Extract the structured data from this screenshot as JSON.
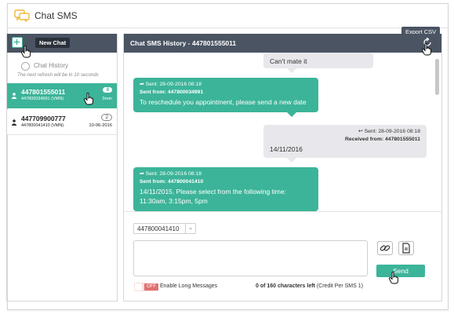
{
  "app": {
    "title": "Chat SMS",
    "export_label": "Export CSV"
  },
  "sidebar": {
    "new_chat_label": "New Chat",
    "history_title": "Chat History",
    "refresh_note": "The next refresh will be in 10 seconds",
    "items": [
      {
        "number": "447801555011",
        "sub": "447800034991 (VMN)",
        "badge": "4",
        "time": "3min",
        "active": true
      },
      {
        "number": "447709900777",
        "sub": "447800041410 (VMN)",
        "badge": "2",
        "time": "10-06-2016",
        "active": false
      }
    ]
  },
  "main": {
    "title": "Chat SMS History - 447801555011",
    "messages": [
      {
        "direction": "in",
        "text": "Can't mate it"
      },
      {
        "direction": "out",
        "sent": "Sent: 28-09-2016 08:18",
        "from": "Sent from: 447800034991",
        "text": "To reschedule you appointment, please send a new date"
      },
      {
        "direction": "in",
        "sent": "Sent: 28-09-2016 08:18",
        "from": "Received from: 447801555011",
        "text": "14/11/2016"
      },
      {
        "direction": "out",
        "sent": "Sent: 28-09-2016 08:18",
        "from": "Sent from: 447800041410",
        "text": "14/11/2015. Please select from the following time:",
        "text2": "11:30am, 3:15pm, 5pm"
      }
    ]
  },
  "compose": {
    "sender": "447800041410",
    "send_label": "Send",
    "toggle_label": "OFF",
    "long_label": "Enable Long Messages",
    "chars_count": "0 of 160 characters left",
    "chars_credit": "(Credit Per SMS 1)"
  },
  "colors": {
    "accent": "#3cb499",
    "header": "#4a5463",
    "dark": "#2b313a"
  }
}
